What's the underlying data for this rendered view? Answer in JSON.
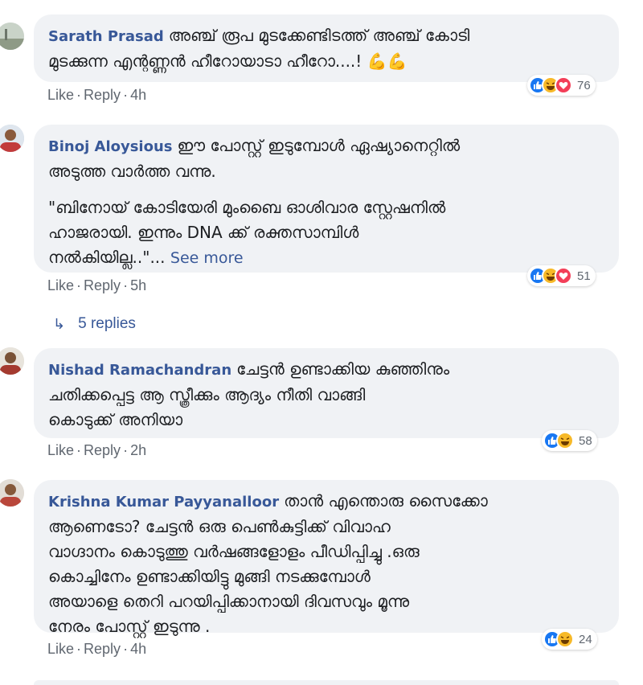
{
  "comments": [
    {
      "author": "Sarath Prasad",
      "text": "അഞ്ച് രൂപ മുടക്കേണ്ടിടത്ത് അഞ്ച് കോടി\nമുടക്കുന്ന എന്റണ്ണൻ ഹീറോയാടാ ഹീറോ....! 💪💪",
      "like": "Like",
      "reply": "Reply",
      "time": "4h",
      "reaction_count": "76",
      "reactions": [
        "like-icon",
        "haha-icon",
        "love-icon"
      ]
    },
    {
      "author": "Binoj Aloysious",
      "text": "ഈ പോസ്റ്റ് ഇടുമ്പോൾ ഏഷ്യാനെറ്റിൽ\nഅടുത്ത വാർത്ത വന്നു.",
      "text2": "\"ബിനോയ് കോടിയേരി മുംബൈ ഓശിവാര സ്റ്റേഷനിൽ\nഹാജരായി. ഇന്നും DNA ക്ക് രക്തസാമ്പിൾ\nനൽകിയില്ല..\"...",
      "see_more": "See more",
      "like": "Like",
      "reply": "Reply",
      "time": "5h",
      "reaction_count": "51",
      "reactions": [
        "like-icon",
        "haha-icon",
        "love-icon"
      ],
      "replies": "5 replies"
    },
    {
      "author": "Nishad Ramachandran",
      "text": "ചേട്ടൻ ഉണ്ടാക്കിയ കുഞ്ഞിനും\nചതിക്കപ്പെട്ട ആ സ്ത്രീക്കും ആദ്യം നീതി വാങ്ങി\nകൊടുക്ക് അനിയാ",
      "like": "Like",
      "reply": "Reply",
      "time": "2h",
      "reaction_count": "58",
      "reactions": [
        "like-icon",
        "haha-icon"
      ]
    },
    {
      "author": "Krishna Kumar Payyanalloor",
      "text": "താൻ എന്തൊരു സൈക്കോ\nആണെടോ? ചേട്ടൻ ഒരു പെൺകുട്ടിക്ക് വിവാഹ\nവാഗ്ദാനം കൊടുത്തു വർഷങ്ങളോളം പീഡിപ്പിച്ചു .ഒരു\nകൊച്ചിനേം ഉണ്ടാക്കിയിട്ടു മുങ്ങി നടക്കുമ്പോൾ\nഅയാളെ തെറി പറയിപ്പിക്കാനായി ദിവസവും മൂന്നു\nനേരം പോസ്റ്റ് ഇടുന്നു .",
      "like": "Like",
      "reply": "Reply",
      "time": "4h",
      "reaction_count": "24",
      "reactions": [
        "like-icon",
        "haha-icon"
      ]
    }
  ],
  "colors": {
    "link": "#385898",
    "bubble": "#f0f2f5",
    "meta": "#606770",
    "like": "#1877f2",
    "haha": "#f7b928",
    "love": "#f33e58"
  }
}
